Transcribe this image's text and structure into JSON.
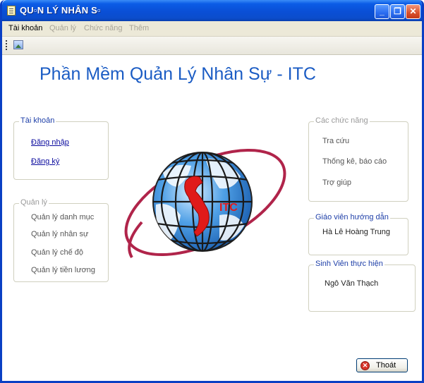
{
  "window": {
    "title": "QU▫N LÝ NHÂN S▫",
    "minimize_glyph": "_",
    "maximize_glyph": "❐",
    "close_glyph": "✕"
  },
  "menu": {
    "items": [
      {
        "label": "Tài khoản",
        "enabled": true
      },
      {
        "label": "Quản lý",
        "enabled": false
      },
      {
        "label": "Chức năng",
        "enabled": false
      },
      {
        "label": "Thêm",
        "enabled": false
      }
    ]
  },
  "toolbar": {
    "items": [
      {
        "icon": "image-icon"
      }
    ]
  },
  "main": {
    "heading": "Phần Mềm Quản Lý Nhân Sự - ITC",
    "logo_text": "ITC"
  },
  "account_group": {
    "title": "Tài khoản",
    "links": [
      "Đăng nhập",
      "Đăng ký"
    ]
  },
  "manage_group": {
    "title": "Quản lý",
    "items": [
      "Quản lý danh mục",
      "Quản lý nhân sự",
      "Quản lý chế độ",
      "Quản lý tiền lương"
    ]
  },
  "functions_group": {
    "title": "Các chức năng",
    "items": [
      "Tra cứu",
      "Thống kê, báo cáo",
      "Trợ giúp"
    ]
  },
  "advisor_group": {
    "title": "Giáo viên hướng dẫn",
    "name": "Hà Lê Hoàng Trung"
  },
  "student_group": {
    "title": "Sinh Viên thực hiện",
    "name": "Ngô Văn Thạch"
  },
  "exit_button": {
    "label": "Thoát",
    "icon": "close-circle-icon"
  },
  "colors": {
    "heading": "#1b5cc4",
    "titlebar": "#0a4fd6",
    "orbit": "#b0244a",
    "globe": "#1f74c8",
    "vietnam_map": "#e01a1a"
  }
}
